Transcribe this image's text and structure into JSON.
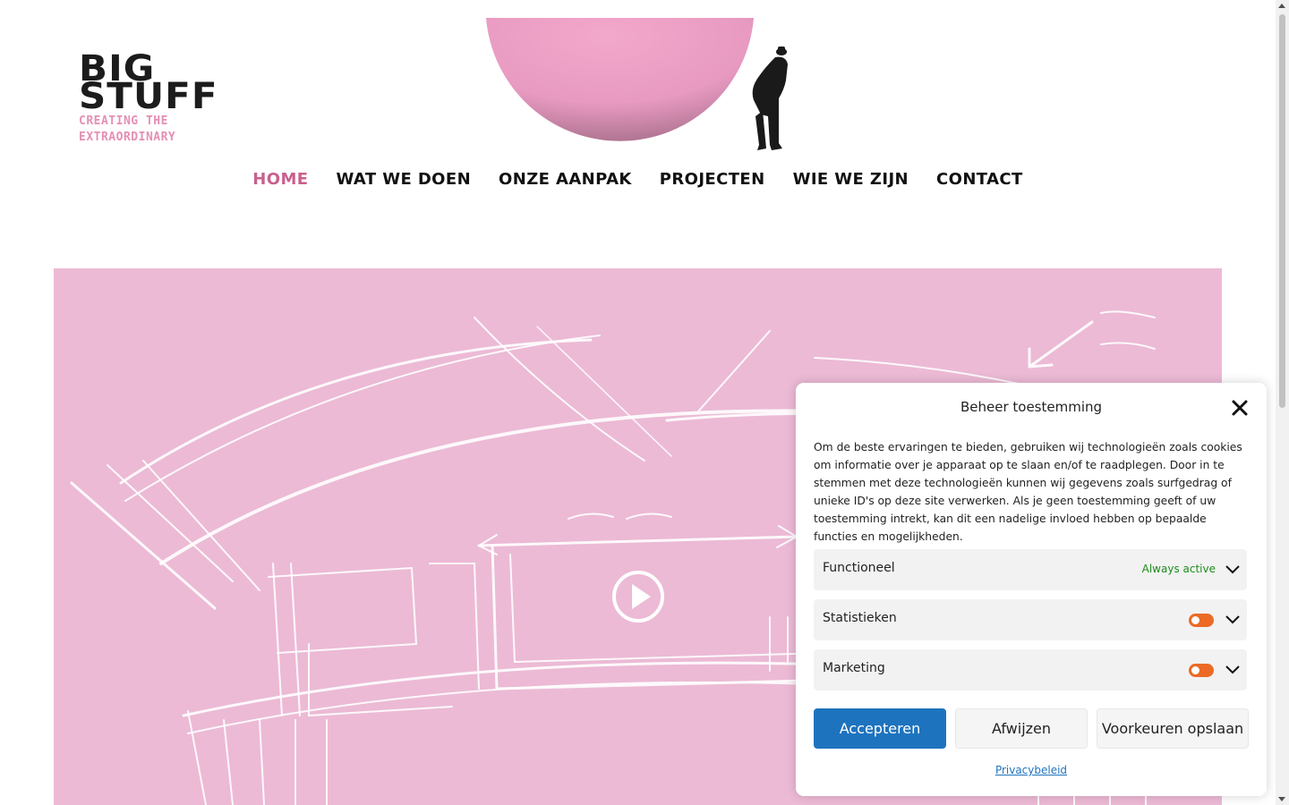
{
  "logo": {
    "line1": "BIG",
    "line2": "STUFF",
    "tagline1": "CREATING THE",
    "tagline2": "EXTRAORDINARY"
  },
  "nav": {
    "items": [
      {
        "label": "HOME",
        "active": true
      },
      {
        "label": "WAT WE DOEN"
      },
      {
        "label": "ONZE AANPAK"
      },
      {
        "label": "PROJECTEN"
      },
      {
        "label": "WIE WE ZIJN"
      },
      {
        "label": "CONTACT"
      }
    ]
  },
  "hero": {
    "background_color": "#ecbad5",
    "play_icon": "play-circle-icon"
  },
  "cookie": {
    "title": "Beheer toestemming",
    "body": "Om de beste ervaringen te bieden, gebruiken wij technologieën zoals cookies om informatie over je apparaat op te slaan en/of te raadplegen. Door in te stemmen met deze technologieën kunnen wij gegevens zoals surfgedrag of unieke ID's op deze site verwerken. Als je geen toestemming geeft of uw toestemming intrekt, kan dit een nadelige invloed hebben op bepaalde functies en mogelijkheden.",
    "categories": [
      {
        "label": "Functioneel",
        "status": "Always active"
      },
      {
        "label": "Statistieken"
      },
      {
        "label": "Marketing"
      }
    ],
    "accept_label": "Accepteren",
    "deny_label": "Afwijzen",
    "save_label": "Voorkeuren opslaan",
    "privacy_label": "Privacybeleid"
  },
  "colors": {
    "accent_pink": "#c9608f",
    "button_blue": "#1e73be",
    "toggle_orange": "#ec6a25",
    "always_active_green": "#1e8c1e"
  }
}
